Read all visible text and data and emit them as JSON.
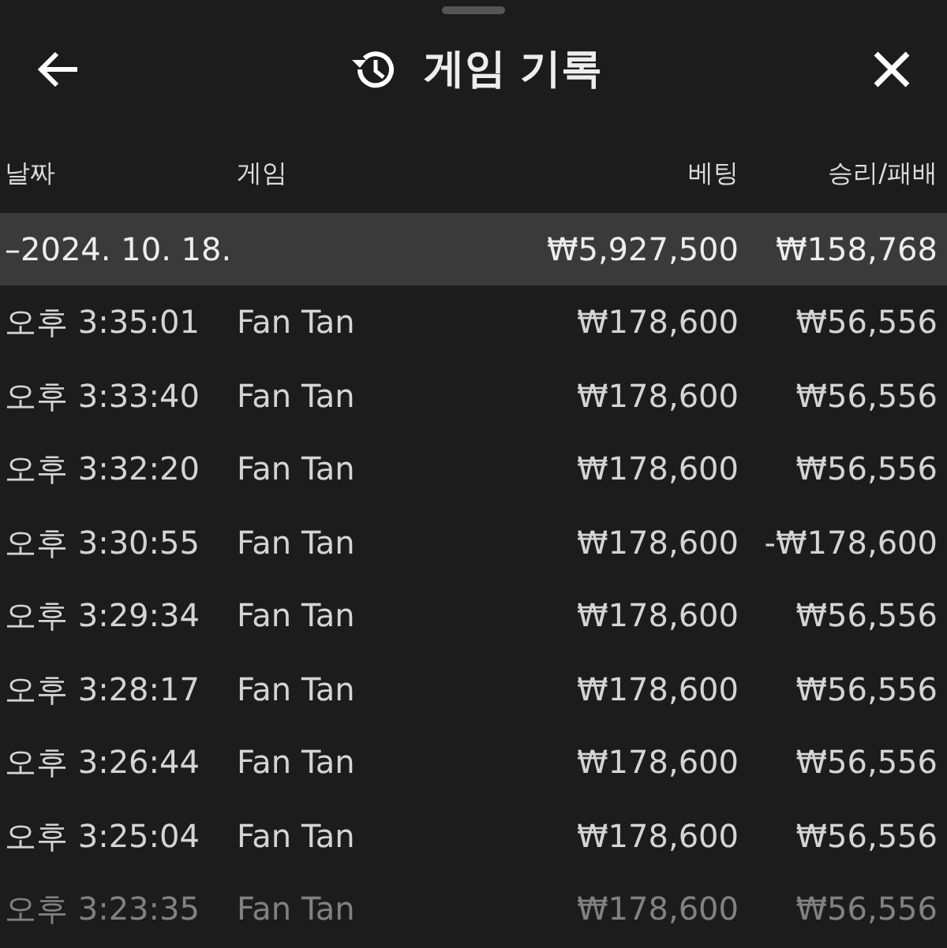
{
  "header": {
    "title": "게임 기록"
  },
  "table": {
    "columns": [
      "날짜",
      "게임",
      "베팅",
      "승리/패배"
    ],
    "groups": [
      {
        "date": "–2024. 10. 18.",
        "bet": "₩5,927,500",
        "result": "₩158,768",
        "rows": [
          {
            "time": "오후 3:35:01",
            "game": "Fan Tan",
            "bet": "₩178,600",
            "result": "₩56,556"
          },
          {
            "time": "오후 3:33:40",
            "game": "Fan Tan",
            "bet": "₩178,600",
            "result": "₩56,556"
          },
          {
            "time": "오후 3:32:20",
            "game": "Fan Tan",
            "bet": "₩178,600",
            "result": "₩56,556"
          },
          {
            "time": "오후 3:30:55",
            "game": "Fan Tan",
            "bet": "₩178,600",
            "result": "-₩178,600"
          },
          {
            "time": "오후 3:29:34",
            "game": "Fan Tan",
            "bet": "₩178,600",
            "result": "₩56,556"
          },
          {
            "time": "오후 3:28:17",
            "game": "Fan Tan",
            "bet": "₩178,600",
            "result": "₩56,556"
          },
          {
            "time": "오후 3:26:44",
            "game": "Fan Tan",
            "bet": "₩178,600",
            "result": "₩56,556"
          },
          {
            "time": "오후 3:25:04",
            "game": "Fan Tan",
            "bet": "₩178,600",
            "result": "₩56,556"
          },
          {
            "time": "오후 3:23:35",
            "game": "Fan Tan",
            "bet": "₩178,600",
            "result": "₩56,556"
          }
        ]
      }
    ]
  }
}
